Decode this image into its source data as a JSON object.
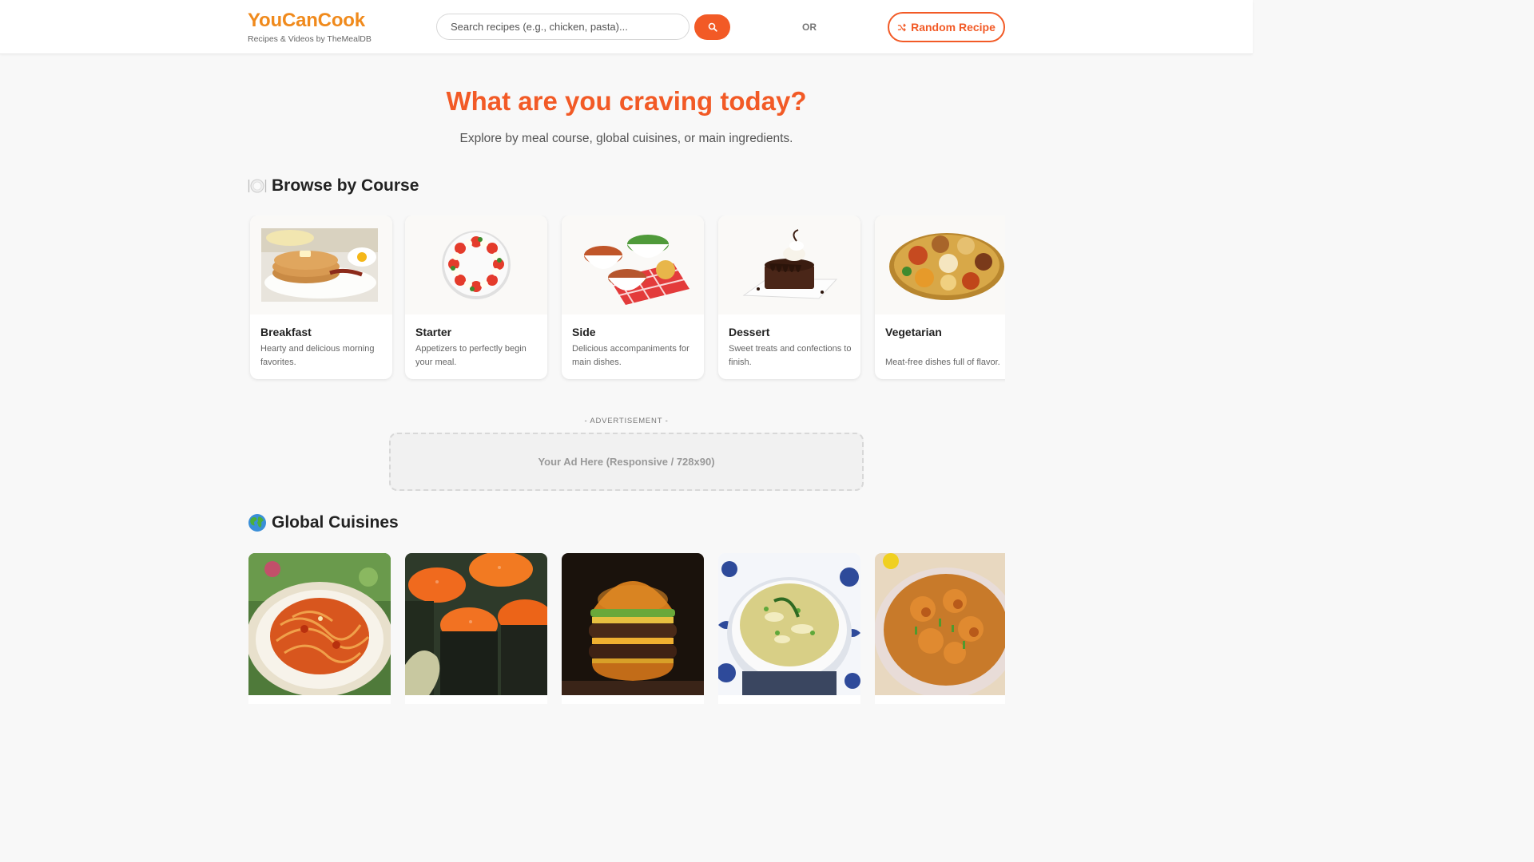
{
  "header": {
    "brand_name": "YouCanCook",
    "brand_subtitle": "Recipes & Videos by TheMealDB",
    "search_placeholder": "Search recipes (e.g., chicken, pasta)...",
    "search_button_icon": "search-icon",
    "or_label": "OR",
    "random_button_label": "Random Recipe",
    "random_button_icon": "shuffle-icon"
  },
  "hero": {
    "title": "What are you craving today?",
    "subtitle": "Explore by meal course, global cuisines, or main ingredients."
  },
  "courses": {
    "icon": "plate-icon",
    "title": "Browse by Course",
    "items": [
      {
        "title": "Breakfast",
        "description": "Hearty and delicious morning favorites."
      },
      {
        "title": "Starter",
        "description": "Appetizers to perfectly begin your meal."
      },
      {
        "title": "Side",
        "description": "Delicious accompaniments for main dishes."
      },
      {
        "title": "Dessert",
        "description": "Sweet treats and confections to finish."
      },
      {
        "title": "Vegetarian",
        "description": "Meat-free dishes full of flavor."
      }
    ]
  },
  "ad": {
    "label": "- ADVERTISEMENT -",
    "placeholder": "Your Ad Here (Responsive / 728x90)"
  },
  "cuisines": {
    "icon": "globe-icon",
    "title": "Global Cuisines",
    "items": [
      {
        "image": "spaghetti"
      },
      {
        "image": "sushi-rolls"
      },
      {
        "image": "burger"
      },
      {
        "image": "egg-drop-soup"
      },
      {
        "image": "curry"
      }
    ]
  },
  "colors": {
    "brand": "#f08a1c",
    "accent": "#f25a26",
    "background": "#f8f8f8"
  }
}
